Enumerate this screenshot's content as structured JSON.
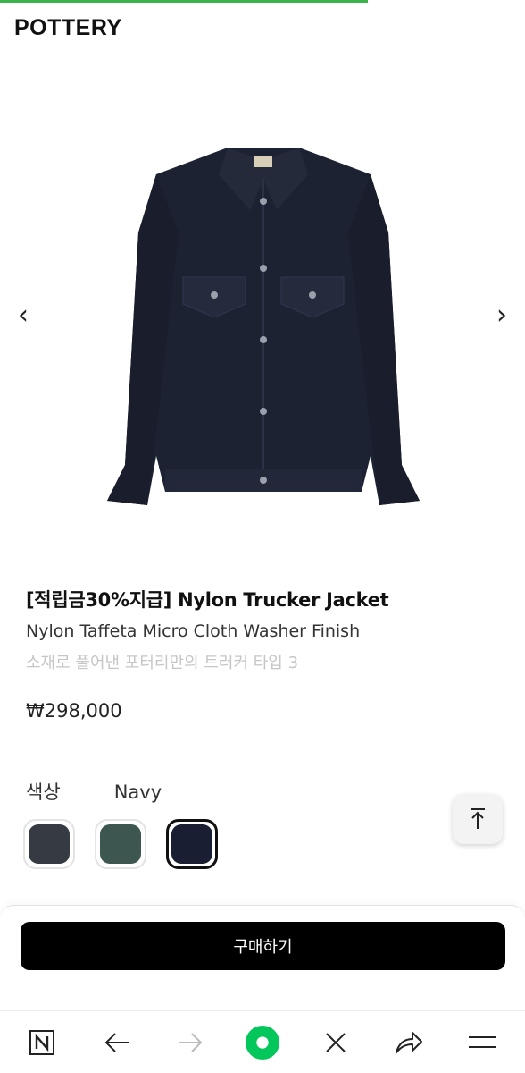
{
  "brand": {
    "logo_text": "POTTERY"
  },
  "gallery": {
    "prev_arrow": "‹",
    "next_arrow": "›",
    "image_icon": "navy-nylon-trucker-jacket-image"
  },
  "product": {
    "title": "[적립금30%지급] Nylon Trucker Jacket",
    "subtitle": "Nylon Taffeta Micro Cloth Washer Finish",
    "description": "소재로 풀어낸 포터리만의 트러커 타입 3",
    "price": "₩298,000"
  },
  "color": {
    "label": "색상",
    "selected_name": "Navy",
    "options": [
      {
        "color": "#363a42"
      },
      {
        "color": "#3e5650"
      },
      {
        "color": "#1a1e33"
      }
    ],
    "selected_index": 2
  },
  "scroll_top": {
    "icon": "arrow-up-to-top-icon"
  },
  "buy": {
    "label": "구매하기"
  },
  "browser_toolbar": {
    "icons": [
      "naver-n-icon",
      "back-arrow-icon",
      "forward-arrow-icon",
      "home-green-circle-icon",
      "close-icon",
      "share-icon",
      "menu-icon"
    ]
  },
  "colors": {
    "load_bar": "#3cb44b",
    "buy_button": "#000000",
    "naver_green": "#03c75a"
  }
}
